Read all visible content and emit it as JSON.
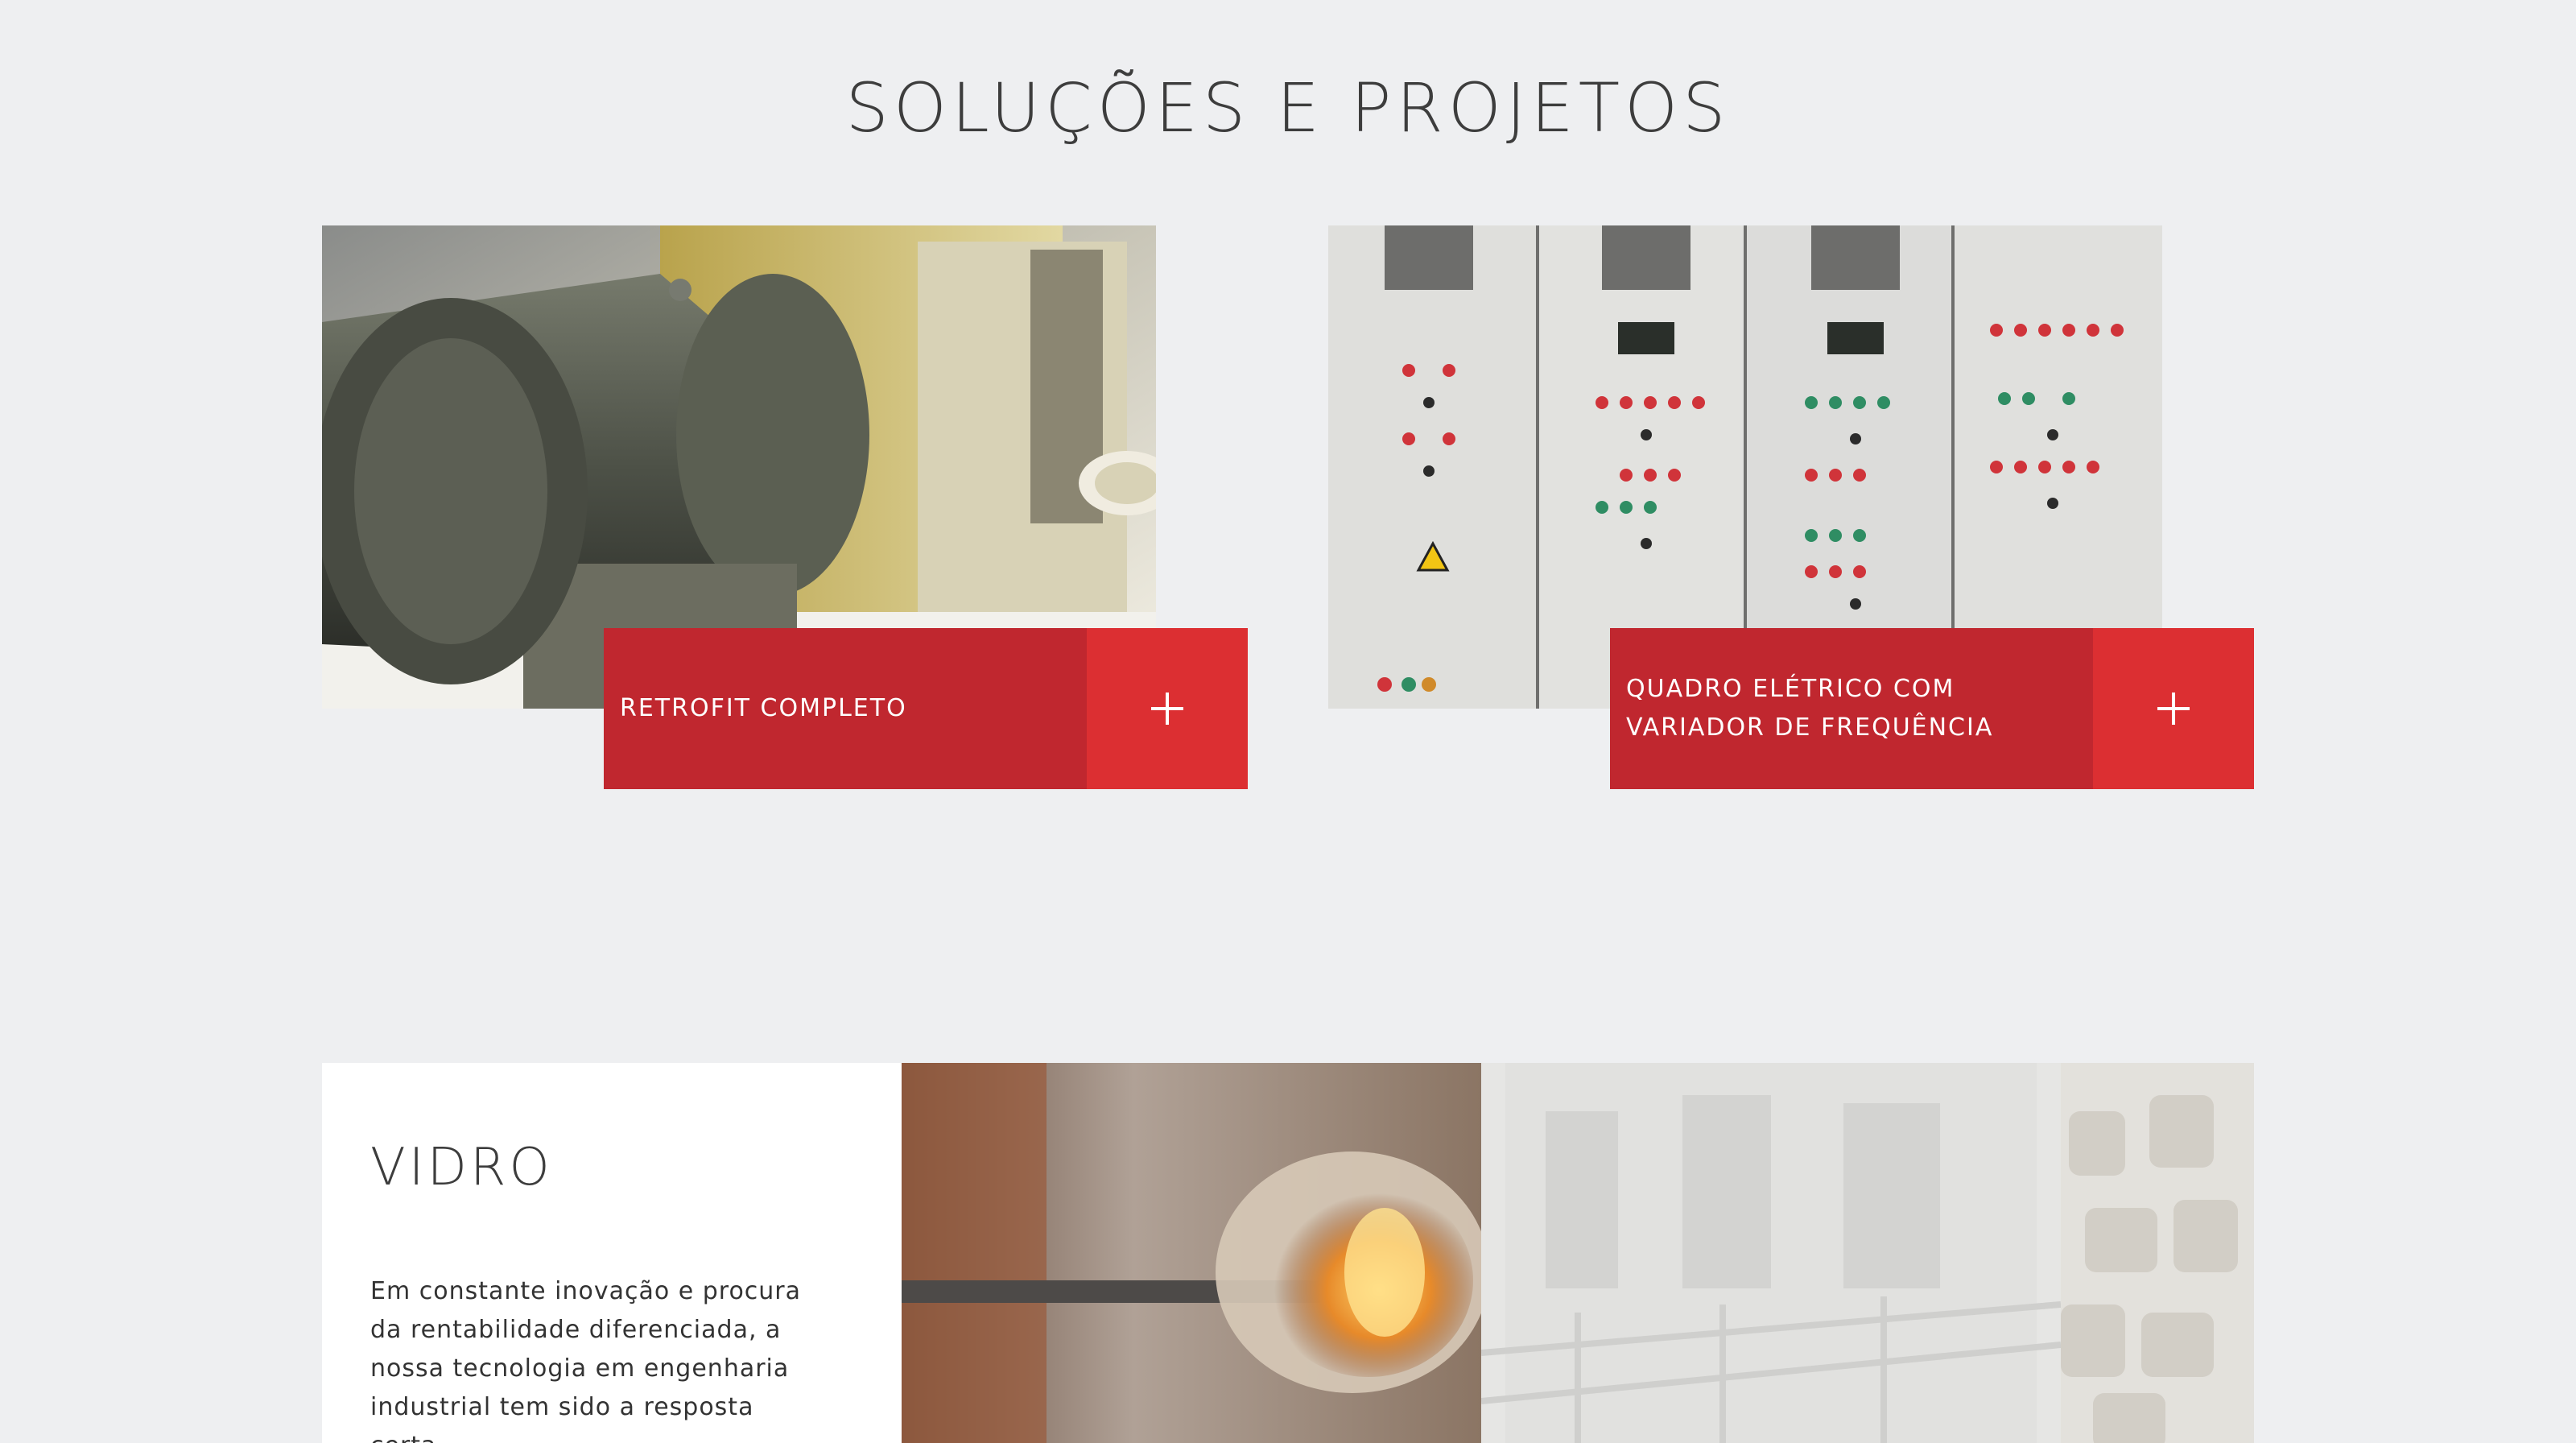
{
  "section": {
    "title": "SOLUÇÕES E PROJETOS"
  },
  "projects": [
    {
      "label": "RETROFIT COMPLETO",
      "image": "industrial-gearbox-coupling-photo",
      "icon": "plus-icon"
    },
    {
      "label": "QUADRO ELÉTRICO COM VARIADOR DE FREQUÊNCIA",
      "image": "electrical-control-panel-photo",
      "icon": "plus-icon"
    }
  ],
  "sectors": {
    "vidro": {
      "title": "VIDRO",
      "text": "Em constante inovação e procura da rentabilidade diferenciada, a nossa tecnologia em engenharia industrial tem sido a resposta certa."
    },
    "images": [
      "glass-blowing-photo",
      "factory-line-photo",
      "cork-stoppers-photo"
    ]
  },
  "colors": {
    "background": "#eeeff1",
    "caption_red": "#c0272f",
    "plus_red": "#dc2f32",
    "heading": "#3d3d3d"
  }
}
